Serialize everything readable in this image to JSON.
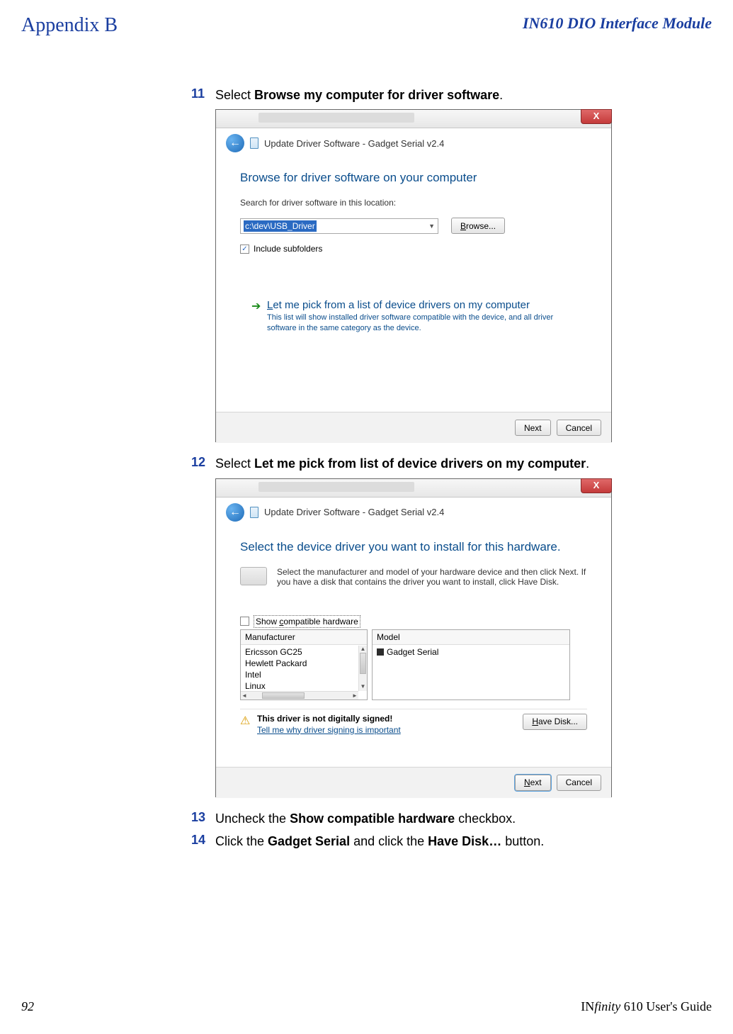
{
  "header": {
    "appendix": "Appendix B",
    "module": "IN610 DIO Interface Module"
  },
  "steps": {
    "s11": {
      "num": "11",
      "prefix": "Select ",
      "bold": "Browse my computer for driver software",
      "suffix": "."
    },
    "s12": {
      "num": "12",
      "prefix": "Select ",
      "bold": "Let me pick from list of device drivers on my computer",
      "suffix": "."
    },
    "s13": {
      "num": "13",
      "prefix": "Uncheck the ",
      "bold": "Show compatible hardware",
      "suffix": " checkbox."
    },
    "s14": {
      "num": "14",
      "prefix": "Click the ",
      "bold1": "Gadget Serial",
      "mid": " and click the ",
      "bold2": "Have Disk…",
      "suffix": " button."
    }
  },
  "dialog1": {
    "close": "X",
    "back_arrow": "←",
    "nav_title": "Update Driver Software - Gadget Serial v2.4",
    "heading": "Browse for driver software on your computer",
    "search_label": "Search for driver software in this location:",
    "path_value": "c:\\dev\\USB_Driver",
    "browse": "Browse...",
    "include_subfolders": "Include subfolders",
    "opt_arrow": "➔",
    "opt_title": "Let me pick from a list of device drivers on my computer",
    "opt_desc": "This list will show installed driver software compatible with the device, and all driver software in the same category as the device.",
    "next": "Next",
    "cancel": "Cancel"
  },
  "dialog2": {
    "close": "X",
    "back_arrow": "←",
    "nav_title": "Update Driver Software - Gadget Serial v2.4",
    "heading": "Select the device driver you want to install for this hardware.",
    "desc": "Select the manufacturer and model of your hardware device and then click Next. If you have a disk that contains the driver you want to install, click Have Disk.",
    "compat_label": "Show compatible hardware",
    "mfr_header": "Manufacturer",
    "mfr_items": [
      "Ericsson GC25",
      "Hewlett Packard",
      "Intel",
      "Linux"
    ],
    "mdl_header": "Model",
    "mdl_item": "Gadget Serial",
    "warn_glyph": "⚠",
    "sign_bold": "This driver is not digitally signed!",
    "sign_link": "Tell me why driver signing is important",
    "have_disk": "Have Disk...",
    "next": "Next",
    "cancel": "Cancel"
  },
  "footer": {
    "page": "92",
    "guide_prefix": "IN",
    "guide_italic": "finity",
    "guide_rest": " 610 User's Guide"
  }
}
